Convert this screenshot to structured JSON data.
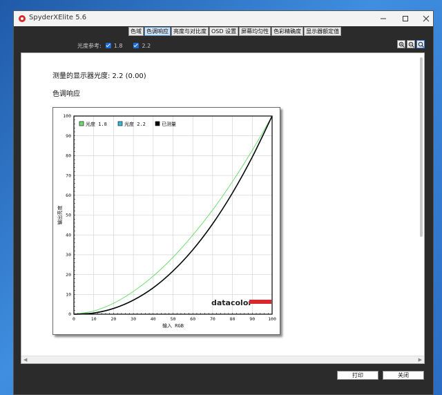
{
  "window": {
    "title": "SpyderXElite 5.6"
  },
  "tabs": [
    {
      "label": "色域"
    },
    {
      "label": "色调响应",
      "active": true
    },
    {
      "label": "亮度与对比度"
    },
    {
      "label": "OSD 设置"
    },
    {
      "label": "屏幕均匀性"
    },
    {
      "label": "色彩精确度"
    },
    {
      "label": "显示器额定值"
    }
  ],
  "reference": {
    "label": "光度参考:",
    "options": [
      {
        "value": "1.8",
        "checked": true
      },
      {
        "value": "2.2",
        "checked": true
      }
    ]
  },
  "content": {
    "measured_text": "测量的显示器光度:  2.2 (0.00)",
    "section_title": "色调响应"
  },
  "chart_data": {
    "type": "line",
    "xlabel": "输入 RGB",
    "ylabel": "输出亮度",
    "xlim": [
      0,
      100
    ],
    "ylim": [
      0,
      100
    ],
    "xticks": [
      0,
      10,
      20,
      30,
      40,
      50,
      60,
      70,
      80,
      90,
      100
    ],
    "yticks": [
      0,
      10,
      20,
      30,
      40,
      50,
      60,
      70,
      80,
      90,
      100
    ],
    "grid": true,
    "legend": "top-left",
    "x": [
      0,
      10,
      20,
      30,
      40,
      50,
      60,
      70,
      80,
      90,
      100
    ],
    "series": [
      {
        "name": "光度 1.8",
        "color": "#6fdc6f",
        "values": [
          0,
          1.6,
          5.5,
          11.5,
          19.2,
          28.7,
          39.9,
          52.6,
          66.9,
          82.7,
          100
        ]
      },
      {
        "name": "光度 2.2",
        "color": "#38b9d6",
        "values": [
          0,
          0.6,
          2.9,
          7.1,
          13.3,
          21.8,
          32.5,
          45.6,
          61.2,
          79.3,
          100
        ]
      },
      {
        "name": "已测量",
        "color": "#0a0a0a",
        "values": [
          0,
          0.6,
          2.9,
          7.1,
          13.3,
          21.8,
          32.5,
          45.6,
          61.2,
          79.3,
          100
        ]
      }
    ],
    "watermark": "datacolor",
    "brand_color": "#d8282e"
  },
  "buttons": {
    "print": "打印",
    "close": "关闭"
  }
}
